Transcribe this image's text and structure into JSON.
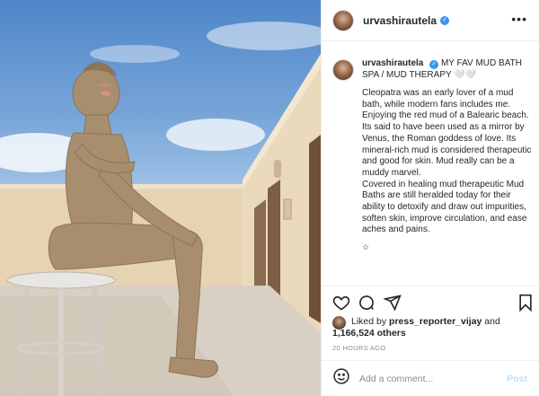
{
  "post": {
    "username": "urvashirautela",
    "verified_badge": "✓",
    "more_icon": "more-horizontal-icon",
    "caption_username": "urvashirautela",
    "caption_title": "MY FAV MUD BATH SPA / MUD THERAPY 🤍🤍",
    "caption_text": "Cleopatra was an early lover of a mud bath, while modern fans includes me. Enjoying the red mud of a Balearic beach.\nIts said to have been used as a mirror by Venus, the Roman goddess of love. Its mineral-rich mud is considered therapeutic and good for skin. Mud really can be a muddy marvel.\nCovered in healing mud therapeutic Mud Baths are still heralded today for their ability to detoxify and draw out impurities, soften skin, improve circulation, and ease aches and pains.",
    "caption_more": "☆",
    "likes_prefix": "Liked by ",
    "liked_by_user": "press_reporter_vijay",
    "likes_and": " and",
    "likes_count": "1,166,524 others",
    "timestamp": "20 HOURS AGO",
    "comment_placeholder": "Add a comment...",
    "post_button": "Post"
  },
  "icons": {
    "like": "heart-icon",
    "comment": "comment-icon",
    "share": "send-icon",
    "save": "bookmark-icon",
    "emoji": "smiley-icon"
  },
  "colors": {
    "link_blue": "#3897f0",
    "post_button_disabled": "#b2dffc",
    "muted_text": "#8e8e8e",
    "divider": "#efefef"
  }
}
